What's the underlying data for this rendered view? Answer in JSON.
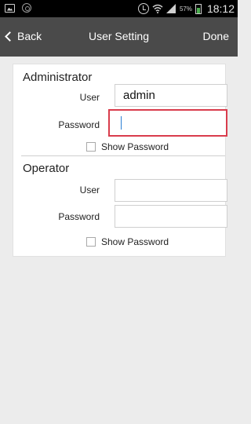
{
  "status_bar": {
    "battery_percent": "57%",
    "time": "18:12",
    "icons": [
      "gallery-icon",
      "camera-icon",
      "alarm-icon",
      "wifi-icon",
      "signal-icon",
      "battery-icon"
    ]
  },
  "header": {
    "back_label": "Back",
    "title": "User Setting",
    "done_label": "Done"
  },
  "administrator": {
    "section_title": "Administrator",
    "user_label": "User",
    "user_value": "admin",
    "password_label": "Password",
    "password_value": "",
    "show_password_label": "Show Password"
  },
  "operator": {
    "section_title": "Operator",
    "user_label": "User",
    "user_value": "",
    "password_label": "Password",
    "password_value": "",
    "show_password_label": "Show Password"
  },
  "colors": {
    "header_bg": "#4a4a4a",
    "page_bg": "#ececec",
    "focus_border": "#d93c4c",
    "caret": "#2a7fd4"
  }
}
